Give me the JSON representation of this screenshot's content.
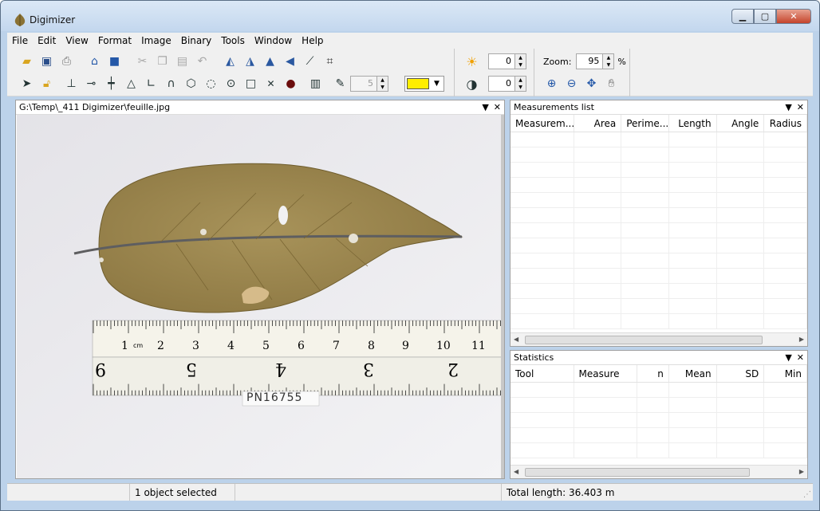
{
  "window": {
    "title": "Digimizer"
  },
  "menu": [
    "File",
    "Edit",
    "View",
    "Format",
    "Image",
    "Binary",
    "Tools",
    "Window",
    "Help"
  ],
  "toolbar": {
    "row1_icons": [
      "open-icon",
      "save-icon",
      "print-icon",
      "scanner-icon",
      "camera-icon",
      "cut-icon",
      "copy-icon",
      "paste-icon",
      "undo-icon",
      "rotate-left-icon",
      "rotate-right-icon",
      "flip-horizontal-icon",
      "flip-vertical-icon",
      "calibrate-icon",
      "crop-icon"
    ],
    "row2_icons": [
      "pointer-icon",
      "lock-icon",
      "marker-icon",
      "line-icon",
      "multi-line-icon",
      "angle-icon",
      "perpendicular-icon",
      "polyline-icon",
      "polygon-icon",
      "closed-curve-icon",
      "circle-icon",
      "rectangle-icon",
      "cross-icon",
      "dot-icon",
      "barcode-icon",
      "brush-icon"
    ],
    "brush_size": "5",
    "color": "#ffee00",
    "brightness": "0",
    "contrast": "0",
    "zoom_label": "Zoom:",
    "zoom_value": "95",
    "zoom_unit": "%",
    "zoom_icons": [
      "zoom-in-icon",
      "zoom-out-icon",
      "move-icon",
      "hand-icon"
    ]
  },
  "document": {
    "path": "G:\\Temp\\_411 Digimizer\\feuille.jpg",
    "ruler_top": [
      "1",
      "cm",
      "2",
      "3",
      "4",
      "5",
      "6",
      "7",
      "8",
      "9",
      "10",
      "11"
    ],
    "ruler_bottom": [
      "9",
      "5",
      "4",
      "3",
      "2"
    ],
    "label": "PN16755"
  },
  "measurements": {
    "title": "Measurements list",
    "columns": [
      "Measurem...",
      "Area",
      "Perime...",
      "Length",
      "Angle",
      "Radius"
    ]
  },
  "statistics": {
    "title": "Statistics",
    "columns": [
      "Tool",
      "Measure",
      "n",
      "Mean",
      "SD",
      "Min"
    ]
  },
  "status": {
    "cell1": "",
    "cell2": "1 object selected",
    "cell3": "",
    "cell4": "Total length: 36.403 m"
  }
}
